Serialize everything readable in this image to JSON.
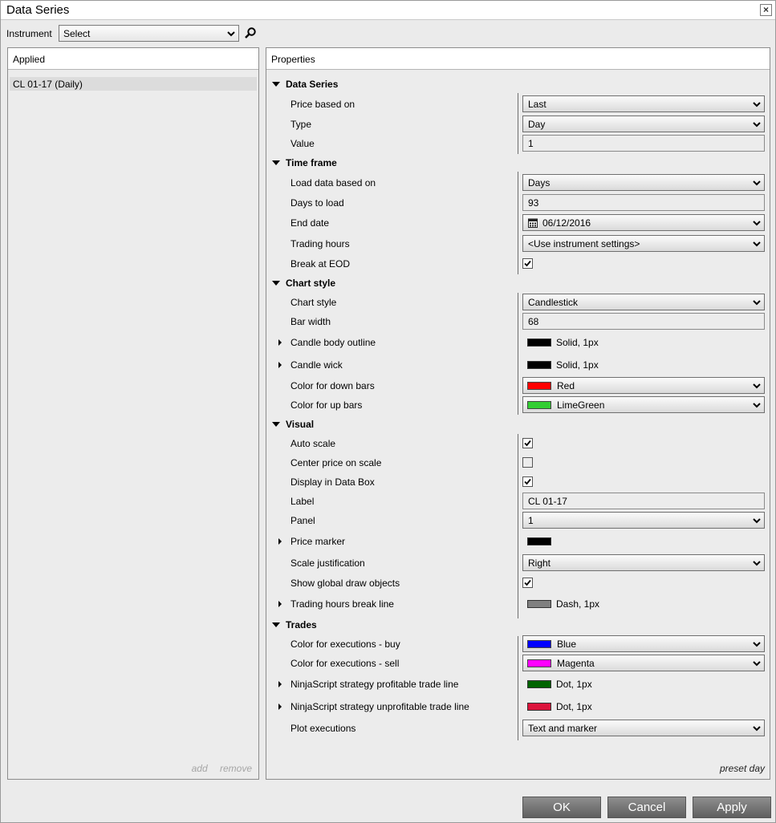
{
  "window": {
    "title": "Data Series",
    "close_label": "×"
  },
  "instrument": {
    "label": "Instrument",
    "value": "Select"
  },
  "applied": {
    "header": "Applied",
    "items": [
      "CL 01-17 (Daily)"
    ],
    "add_label": "add",
    "remove_label": "remove"
  },
  "properties": {
    "header": "Properties",
    "preset_label": "preset day",
    "categories": {
      "data_series": "Data Series",
      "time_frame": "Time frame",
      "chart_style": "Chart style",
      "visual": "Visual",
      "trades": "Trades"
    },
    "labels": {
      "price_based_on": "Price based on",
      "type": "Type",
      "value": "Value",
      "load_data_based_on": "Load data based on",
      "days_to_load": "Days to load",
      "end_date": "End date",
      "trading_hours": "Trading hours",
      "break_at_eod": "Break at EOD",
      "chart_style": "Chart style",
      "bar_width": "Bar width",
      "candle_body_outline": "Candle body outline",
      "candle_wick": "Candle wick",
      "color_down_bars": "Color for down bars",
      "color_up_bars": "Color for up bars",
      "auto_scale": "Auto scale",
      "center_price": "Center price on scale",
      "display_data_box": "Display in Data Box",
      "label": "Label",
      "panel": "Panel",
      "price_marker": "Price marker",
      "scale_justification": "Scale justification",
      "show_global_draw": "Show global draw objects",
      "trading_hours_break": "Trading hours break line",
      "exec_buy": "Color for executions - buy",
      "exec_sell": "Color for executions - sell",
      "profitable_line": "NinjaScript strategy profitable trade line",
      "unprofitable_line": "NinjaScript strategy unprofitable trade line",
      "plot_executions": "Plot executions"
    },
    "values": {
      "price_based_on": "Last",
      "type": "Day",
      "value": "1",
      "load_data_based_on": "Days",
      "days_to_load": "93",
      "end_date": "06/12/2016",
      "trading_hours": "<Use instrument settings>",
      "break_at_eod": true,
      "chart_style": "Candlestick",
      "bar_width": "68",
      "candle_body_outline": "Solid, 1px",
      "candle_wick": "Solid, 1px",
      "color_down_bars": "Red",
      "color_up_bars": "LimeGreen",
      "auto_scale": true,
      "center_price": false,
      "display_data_box": true,
      "label": "CL 01-17",
      "panel": "1",
      "scale_justification": "Right",
      "show_global_draw": true,
      "trading_hours_break": "Dash, 1px",
      "exec_buy": "Blue",
      "exec_sell": "Magenta",
      "profitable_line": "Dot, 1px",
      "unprofitable_line": "Dot, 1px",
      "plot_executions": "Text and marker"
    },
    "colors": {
      "candle_body_outline": "#000000",
      "candle_wick": "#000000",
      "down_bars": "#ff0000",
      "up_bars": "#32cd32",
      "price_marker": "#000000",
      "trading_hours_break": "#808080",
      "exec_buy": "#0000ff",
      "exec_sell": "#ff00ff",
      "profitable_line": "#006400",
      "unprofitable_line": "#dc143c"
    }
  },
  "buttons": {
    "ok": "OK",
    "cancel": "Cancel",
    "apply": "Apply"
  }
}
